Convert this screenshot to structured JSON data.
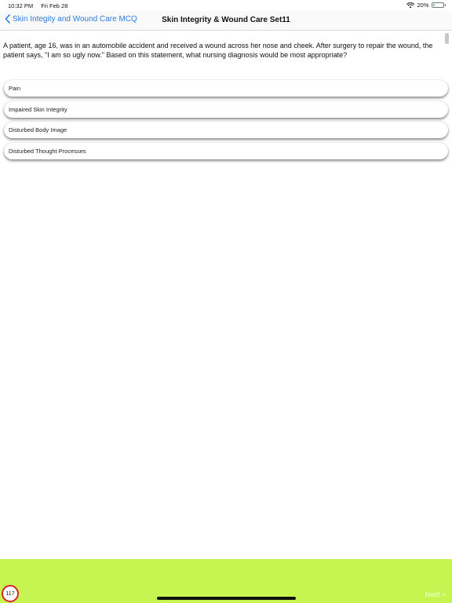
{
  "status_bar": {
    "time": "10:32 PM",
    "date": "Fri Feb 28",
    "battery_percent": "20%",
    "battery_level": 0.2,
    "icons": [
      "wifi-icon",
      "battery-icon"
    ]
  },
  "nav": {
    "back_label": "Skin Integity and Wound Care MCQ",
    "title": "Skin Integrity & Wound Care Set11",
    "back_icon": "chevron-left-icon",
    "accent_color": "#2a7ae2"
  },
  "question": {
    "text": "A patient, age 16, was in an automobile accident and received a wound across her nose and cheek. After surgery to repair the wound, the patient says, \"I am so ugly now.\" Based on this statement, what nursing diagnosis would be most appropriate?"
  },
  "options": [
    {
      "label": "Pain"
    },
    {
      "label": "Impaired Skin Integrity"
    },
    {
      "label": "Disturbed Body Image"
    },
    {
      "label": "Disturbed Thought Processes"
    }
  ],
  "footer": {
    "counter": "117",
    "next_label": "Next >",
    "bar_color": "#c6f551",
    "badge_color": "#d9232d"
  }
}
